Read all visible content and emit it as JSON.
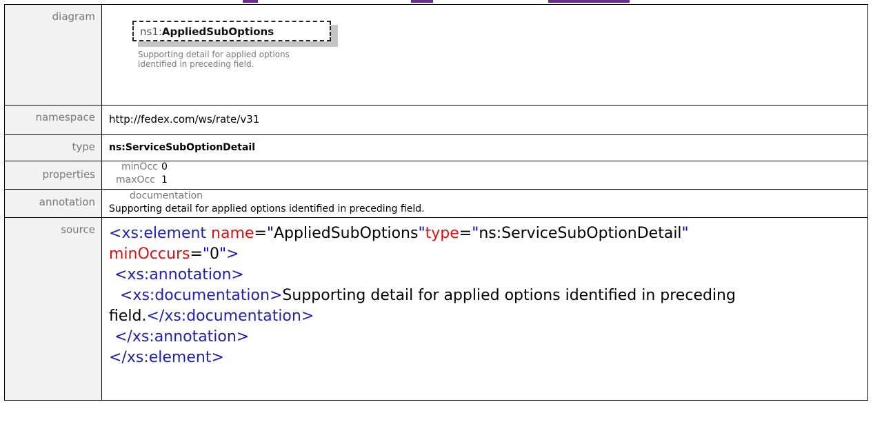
{
  "rows": {
    "diagram": {
      "label": "diagram",
      "element_prefix": "ns1:",
      "element_name": "AppliedSubOptions",
      "doc": "Supporting detail for applied options identified in preceding field."
    },
    "namespace": {
      "label": "namespace",
      "value": "http://fedex.com/ws/rate/v31"
    },
    "type": {
      "label": "type",
      "value": "ns:ServiceSubOptionDetail"
    },
    "properties": {
      "label": "properties",
      "min_label": "minOcc",
      "min_value": "0",
      "max_label": "maxOcc",
      "max_value": "1"
    },
    "annotation": {
      "label": "annotation",
      "doc_label": "documentation",
      "doc_text": "Supporting detail for applied options identified in preceding field."
    },
    "source": {
      "label": "source",
      "line1_open": "<xs:element",
      "attr_name": "name",
      "attr_name_val": "AppliedSubOptions",
      "attr_type": "type",
      "attr_type_val": "ns:ServiceSubOptionDetail",
      "attr_min": "minOccurs",
      "attr_min_val": "0",
      "annot_open": "<xs:annotation>",
      "doc_open": "<xs:documentation>",
      "doc_text_a": "Supporting detail for applied options identified in preceding",
      "doc_text_b": "field.",
      "doc_close": "</xs:documentation>",
      "annot_close": "</xs:annotation>",
      "elem_close": "</xs:element>"
    }
  },
  "colors": {
    "label_text": "#777777",
    "tag": "#8a0000",
    "attribute": "#e01010",
    "value": "#0000d0",
    "top_link_bar": "#6b2b8f"
  }
}
